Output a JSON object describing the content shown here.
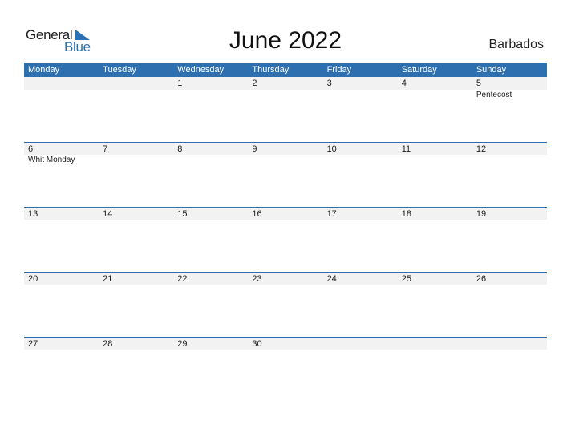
{
  "logo": {
    "word1": "General",
    "word2": "Blue"
  },
  "title": "June 2022",
  "country": "Barbados",
  "weekdays": [
    "Monday",
    "Tuesday",
    "Wednesday",
    "Thursday",
    "Friday",
    "Saturday",
    "Sunday"
  ],
  "weeks": [
    {
      "days": [
        "",
        "",
        "1",
        "2",
        "3",
        "4",
        "5"
      ],
      "events": [
        "",
        "",
        "",
        "",
        "",
        "",
        "Pentecost"
      ]
    },
    {
      "days": [
        "6",
        "7",
        "8",
        "9",
        "10",
        "11",
        "12"
      ],
      "events": [
        "Whit Monday",
        "",
        "",
        "",
        "",
        "",
        ""
      ]
    },
    {
      "days": [
        "13",
        "14",
        "15",
        "16",
        "17",
        "18",
        "19"
      ],
      "events": [
        "",
        "",
        "",
        "",
        "",
        "",
        ""
      ]
    },
    {
      "days": [
        "20",
        "21",
        "22",
        "23",
        "24",
        "25",
        "26"
      ],
      "events": [
        "",
        "",
        "",
        "",
        "",
        "",
        ""
      ]
    },
    {
      "days": [
        "27",
        "28",
        "29",
        "30",
        "",
        "",
        ""
      ],
      "events": [
        "",
        "",
        "",
        "",
        "",
        "",
        ""
      ]
    }
  ],
  "colors": {
    "accent": "#2e6fb0",
    "row_bg": "#f2f2f2"
  }
}
